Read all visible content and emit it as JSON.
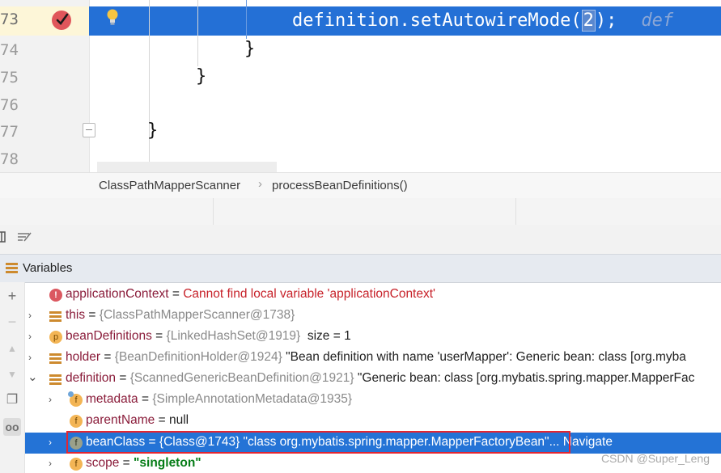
{
  "editor": {
    "gutter_lines": [
      "73",
      "74",
      "75",
      "76",
      "77",
      "78"
    ],
    "exec_line": {
      "prefix": "definition.setAutowireMode(",
      "caret_char": "2",
      "suffix": ");",
      "hint": "def"
    },
    "lines": [
      "}",
      "}",
      "}"
    ]
  },
  "breadcrumb": {
    "items": [
      "ClassPathMapperScanner",
      "processBeanDefinitions()"
    ],
    "separator": "›"
  },
  "panel": {
    "title": "Variables"
  },
  "side_toolbar": {
    "buttons": [
      {
        "icon": "plus-icon",
        "glyph": "+"
      },
      {
        "icon": "minus-icon",
        "glyph": "−"
      },
      {
        "icon": "move-up-icon",
        "glyph": "▲"
      },
      {
        "icon": "move-down-icon",
        "glyph": "▼"
      },
      {
        "icon": "copy-icon",
        "glyph": "❐"
      },
      {
        "icon": "glasses-icon",
        "glyph": "oo"
      }
    ]
  },
  "variables": [
    {
      "icon": "error-icon",
      "name": "applicationContext",
      "eq": " = ",
      "value": "Cannot find local variable 'applicationContext'",
      "kind": "error"
    },
    {
      "icon": "list-icon",
      "expand": "›",
      "name": "this",
      "eq": " = ",
      "ref": "{ClassPathMapperScanner@1738}"
    },
    {
      "icon": "param-icon",
      "expand": "›",
      "name": "beanDefinitions",
      "eq": " = ",
      "ref": "{LinkedHashSet@1919}",
      "extra": "  size = 1"
    },
    {
      "icon": "list-icon",
      "expand": "›",
      "name": "holder",
      "eq": " = ",
      "ref": "{BeanDefinitionHolder@1924}",
      "extra": " \"Bean definition with name 'userMapper': Generic bean: class [org.myba"
    },
    {
      "icon": "list-icon",
      "expand": "⌄",
      "name": "definition",
      "eq": " = ",
      "ref": "{ScannedGenericBeanDefinition@1921}",
      "extra": " \"Generic bean: class [org.mybatis.spring.mapper.MapperFac"
    },
    {
      "icon": "field-icon",
      "expand": "›",
      "name": "metadata",
      "eq": " = ",
      "ref": "{SimpleAnnotationMetadata@1935}"
    },
    {
      "icon": "field-icon",
      "name": "parentName",
      "eq": " = ",
      "extra": "null"
    },
    {
      "icon": "field-icon",
      "expand": "›",
      "name": "beanClass",
      "eq": " = ",
      "ref": "{Class@1743}",
      "extra": " \"class org.mybatis.spring.mapper.MapperFactoryBean\"",
      "nav": "... Navigate",
      "selected": true
    },
    {
      "icon": "field-icon",
      "expand": "›",
      "name": "scope",
      "eq": " = ",
      "strg": "\"singleton\""
    }
  ],
  "watermark": "CSDN @Super_Leng",
  "colors": {
    "selection": "#2473d6",
    "highlight_box": "#e32631",
    "breakpoint": "#e0565b"
  }
}
